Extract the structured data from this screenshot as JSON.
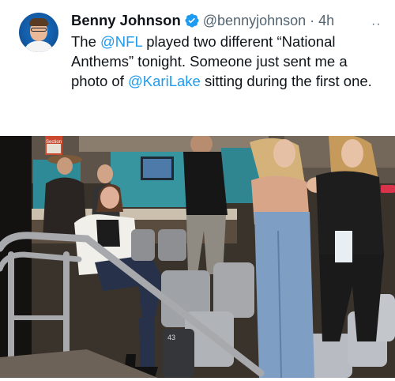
{
  "tweet": {
    "display_name": "Benny Johnson",
    "handle_and_time": "@bennyjohnson · 4h",
    "more_label": "··",
    "text": {
      "part1": "The ",
      "mention_nfl": "@NFL",
      "part2": " played two different “National Anthems” tonight. Someone just sent me a photo of ",
      "mention_lake": "@KariLake",
      "part3": " sitting during the first one."
    }
  },
  "photo": {
    "sign_text": "Section",
    "seat_number": "43"
  },
  "colors": {
    "link": "#1d9bf0",
    "verified": "#1d9bf0",
    "secondary_text": "#536471"
  },
  "icons": {
    "verified": "verified-badge-icon",
    "more": "more-options-icon"
  }
}
